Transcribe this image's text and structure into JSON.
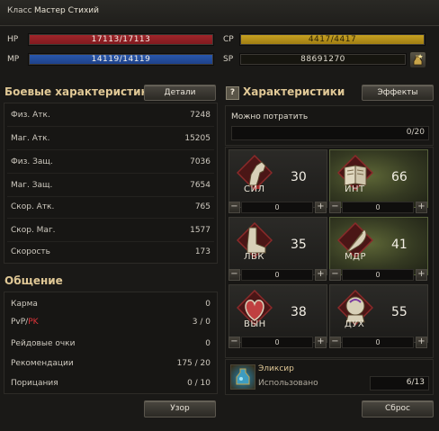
{
  "header": {
    "class_label": "Класс",
    "class_value": "Мастер Стихий"
  },
  "vitals": {
    "hp": {
      "label": "HP",
      "value": "17113/17113",
      "fill": 1.0
    },
    "mp": {
      "label": "MP",
      "value": "14119/14119",
      "fill": 1.0
    },
    "cp": {
      "label": "CP",
      "value": "4417/4417",
      "fill": 1.0
    },
    "sp": {
      "label": "SP",
      "value": "88691270"
    },
    "sp_icon": "sp-potion-icon"
  },
  "combat": {
    "title": "Боевые характеристики",
    "details_button": "Детали",
    "rows": [
      {
        "label": "Физ. Атк.",
        "value": "7248"
      },
      {
        "label": "Маг. Атк.",
        "value": "15205"
      },
      {
        "label": "Физ. Защ.",
        "value": "7036"
      },
      {
        "label": "Маг. Защ.",
        "value": "7654"
      },
      {
        "label": "Скор. Атк.",
        "value": "765"
      },
      {
        "label": "Скор. Маг.",
        "value": "1577"
      },
      {
        "label": "Скорость",
        "value": "173"
      }
    ]
  },
  "social": {
    "title": "Общение",
    "rows": [
      {
        "label": "Карма",
        "value": "0"
      },
      {
        "label_prefix": "PvP/",
        "label_pk": "PK",
        "value": "3 / 0"
      },
      {
        "label": "Рейдовые очки",
        "value": "0"
      },
      {
        "label": "Рекомендации",
        "value": "175 / 20"
      },
      {
        "label": "Порицания",
        "value": "0 / 10"
      }
    ],
    "pattern_button": "Узор"
  },
  "characteristics": {
    "help_icon": "?",
    "title": "Характеристики",
    "effects_button": "Эффекты",
    "spend_label": "Можно потратить",
    "spend_value": "0/20",
    "stats": [
      {
        "name": "СИЛ",
        "value": "30",
        "alloc": "0",
        "icon": "arm-icon",
        "highlight": false
      },
      {
        "name": "ИНТ",
        "value": "66",
        "alloc": "0",
        "icon": "book-icon",
        "highlight": true
      },
      {
        "name": "ЛВК",
        "value": "35",
        "alloc": "0",
        "icon": "foot-icon",
        "highlight": false
      },
      {
        "name": "МДР",
        "value": "41",
        "alloc": "0",
        "icon": "feather-icon",
        "highlight": true
      },
      {
        "name": "ВЫН",
        "value": "38",
        "alloc": "0",
        "icon": "heart-icon",
        "highlight": false
      },
      {
        "name": "ДУХ",
        "value": "55",
        "alloc": "0",
        "icon": "head-icon",
        "highlight": false
      }
    ],
    "elixir": {
      "title": "Эликсир",
      "used_label": "Использовано",
      "used_value": "6/13",
      "icon": "elixir-icon"
    },
    "reset_button": "Сброс"
  }
}
